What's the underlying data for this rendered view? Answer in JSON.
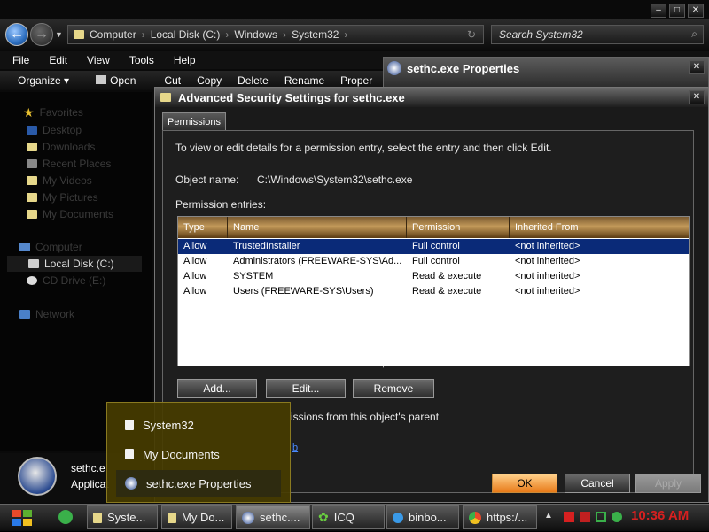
{
  "explorer": {
    "nav": {
      "breadcrumb": [
        "Computer",
        "Local Disk (C:)",
        "Windows",
        "System32"
      ],
      "search_placeholder": "Search System32"
    },
    "menu": [
      "File",
      "Edit",
      "View",
      "Tools",
      "Help"
    ],
    "toolbar": [
      "Organize ▾",
      "Open",
      "Cut",
      "Copy",
      "Delete",
      "Rename",
      "Proper"
    ],
    "navpane": {
      "favorites": "Favorites",
      "fav_items": [
        "Desktop",
        "Downloads",
        "Recent Places",
        "My Videos",
        "My Pictures",
        "My Documents"
      ],
      "computer": "Computer",
      "drives": [
        "Local Disk (C:)",
        "CD Drive (E:)"
      ],
      "network": "Network"
    },
    "details": {
      "name": "sethc.e",
      "type": "Applicat"
    }
  },
  "properties_window": {
    "title": "sethc.exe Properties"
  },
  "advanced_security": {
    "title": "Advanced Security Settings for sethc.exe",
    "tab": "Permissions",
    "instructions": "To view or edit details for a permission entry, select the entry and then click Edit.",
    "object_name_label": "Object name:",
    "object_name_value": "C:\\Windows\\System32\\sethc.exe",
    "entries_label": "Permission entries:",
    "columns": [
      "Type",
      "Name",
      "Permission",
      "Inherited From"
    ],
    "rows": [
      {
        "type": "Allow",
        "name": "TrustedInstaller",
        "permission": "Full control",
        "inherited": "<not inherited>"
      },
      {
        "type": "Allow",
        "name": "Administrators (FREEWARE-SYS\\Ad...",
        "permission": "Full control",
        "inherited": "<not inherited>"
      },
      {
        "type": "Allow",
        "name": "SYSTEM",
        "permission": "Read & execute",
        "inherited": "<not inherited>"
      },
      {
        "type": "Allow",
        "name": "Users (FREEWARE-SYS\\Users)",
        "permission": "Read & execute",
        "inherited": "<not inherited>"
      }
    ],
    "buttons": {
      "add": "Add...",
      "edit": "Edit...",
      "remove": "Remove"
    },
    "inherit_text": "issions from this object's parent",
    "link_text": "b",
    "footer": {
      "ok": "OK",
      "cancel": "Cancel",
      "apply": "Apply"
    }
  },
  "jumplist": {
    "items": [
      "System32",
      "My Documents",
      "sethc.exe Properties"
    ]
  },
  "taskbar": {
    "items": [
      "Syste...",
      "My Do...",
      "sethc....",
      "ICQ",
      "binbo...",
      "https:/..."
    ],
    "clock": "10:36 AM"
  },
  "colors": {
    "accent_red": "#d62020",
    "selected_row": "#0a2a78",
    "ok_button": "#f0a040"
  }
}
